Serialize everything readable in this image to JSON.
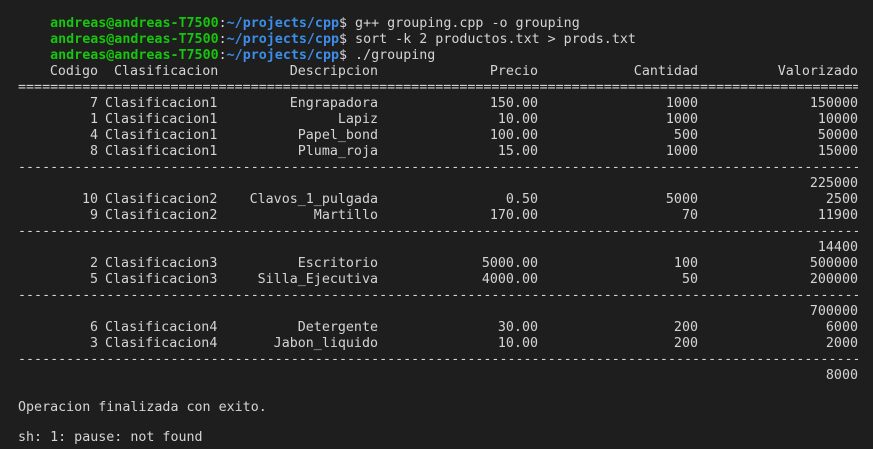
{
  "prompts": [
    {
      "user": "andreas@andreas-T7500",
      "sep": ":",
      "path": "~/projects/cpp",
      "sym": "$",
      "command": " g++ grouping.cpp -o grouping"
    },
    {
      "user": "andreas@andreas-T7500",
      "sep": ":",
      "path": "~/projects/cpp",
      "sym": "$",
      "command": " sort -k 2 productos.txt > prods.txt"
    },
    {
      "user": "andreas@andreas-T7500",
      "sep": ":",
      "path": "~/projects/cpp",
      "sym": "$",
      "command": " ./grouping"
    }
  ],
  "table": {
    "headers": {
      "codigo": "Codigo",
      "clasificacion": "Clasificacion",
      "descripcion": "Descripcion",
      "precio": "Precio",
      "cantidad": "Cantidad",
      "valorizado": "Valorizado"
    },
    "double_rule": "============================================================================================================================",
    "single_rule": "----------------------------------------------------------------------------------------------------------------------------",
    "groups": [
      {
        "rows": [
          {
            "codigo": "7",
            "clasificacion": "Clasificacion1",
            "descripcion": "Engrapadora",
            "precio": "150.00",
            "cantidad": "1000",
            "valorizado": "150000"
          },
          {
            "codigo": "1",
            "clasificacion": "Clasificacion1",
            "descripcion": "Lapiz",
            "precio": "10.00",
            "cantidad": "1000",
            "valorizado": "10000"
          },
          {
            "codigo": "4",
            "clasificacion": "Clasificacion1",
            "descripcion": "Papel_bond",
            "precio": "100.00",
            "cantidad": "500",
            "valorizado": "50000"
          },
          {
            "codigo": "8",
            "clasificacion": "Clasificacion1",
            "descripcion": "Pluma_roja",
            "precio": "15.00",
            "cantidad": "1000",
            "valorizado": "15000"
          }
        ],
        "total": "225000"
      },
      {
        "rows": [
          {
            "codigo": "10",
            "clasificacion": "Clasificacion2",
            "descripcion": "Clavos_1_pulgada",
            "precio": "0.50",
            "cantidad": "5000",
            "valorizado": "2500"
          },
          {
            "codigo": "9",
            "clasificacion": "Clasificacion2",
            "descripcion": "Martillo",
            "precio": "170.00",
            "cantidad": "70",
            "valorizado": "11900"
          }
        ],
        "total": "14400"
      },
      {
        "rows": [
          {
            "codigo": "2",
            "clasificacion": "Clasificacion3",
            "descripcion": "Escritorio",
            "precio": "5000.00",
            "cantidad": "100",
            "valorizado": "500000"
          },
          {
            "codigo": "5",
            "clasificacion": "Clasificacion3",
            "descripcion": "Silla_Ejecutiva",
            "precio": "4000.00",
            "cantidad": "50",
            "valorizado": "200000"
          }
        ],
        "total": "700000"
      },
      {
        "rows": [
          {
            "codigo": "6",
            "clasificacion": "Clasificacion4",
            "descripcion": "Detergente",
            "precio": "30.00",
            "cantidad": "200",
            "valorizado": "6000"
          },
          {
            "codigo": "3",
            "clasificacion": "Clasificacion4",
            "descripcion": "Jabon_liquido",
            "precio": "10.00",
            "cantidad": "200",
            "valorizado": "2000"
          }
        ],
        "total": "8000"
      }
    ]
  },
  "messages": {
    "finished": "Operacion finalizada con exito.",
    "pause_error": "sh: 1: pause: not found"
  },
  "colors": {
    "background": "#1e1e1e",
    "user_green": "#16c60c",
    "path_blue": "#3b8eea",
    "text": "#d4d4d4"
  }
}
